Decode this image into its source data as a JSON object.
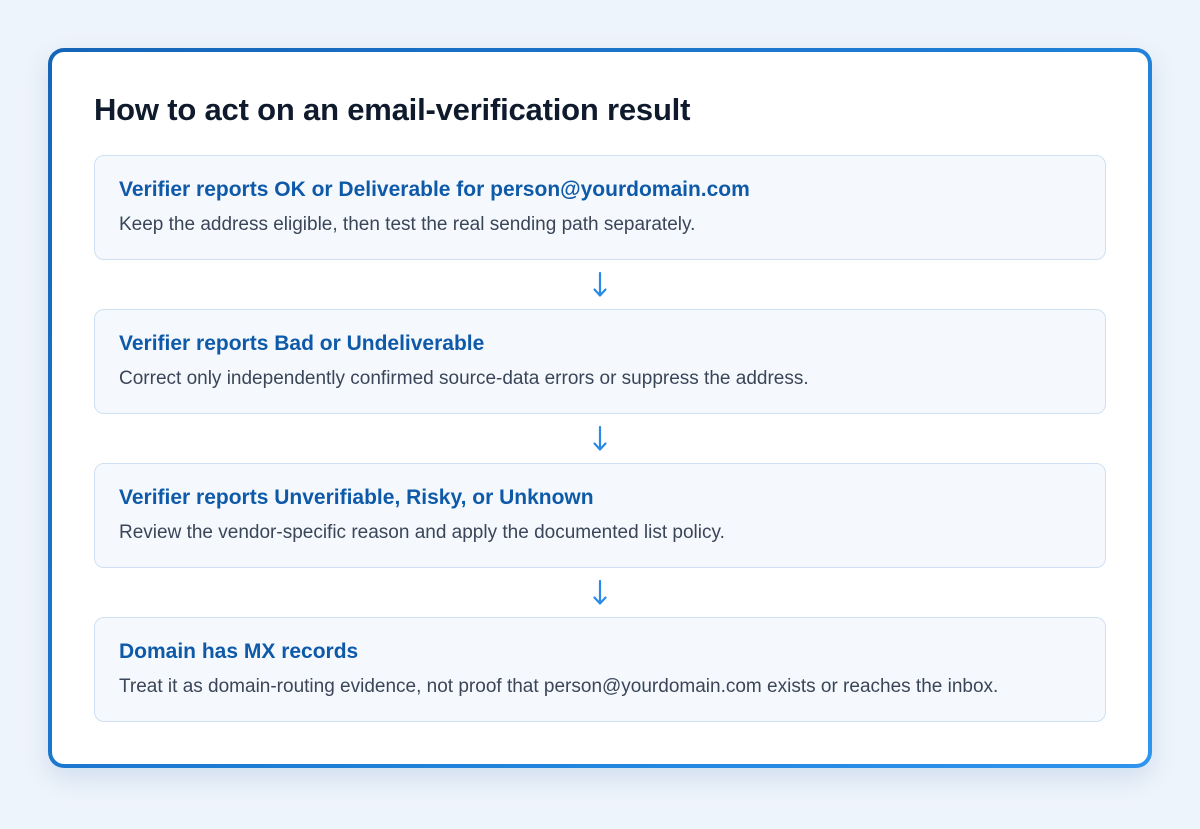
{
  "title": "How to act on an email-verification result",
  "steps": [
    {
      "heading": "Verifier reports OK or Deliverable for person@yourdomain.com",
      "description": "Keep the address eligible, then test the real sending path separately."
    },
    {
      "heading": "Verifier reports Bad or Undeliverable",
      "description": "Correct only independently confirmed source-data errors or suppress the address."
    },
    {
      "heading": "Verifier reports Unverifiable, Risky, or Unknown",
      "description": "Review the vendor-specific reason and apply the documented list policy."
    },
    {
      "heading": "Domain has MX records",
      "description": "Treat it as domain-routing evidence, not proof that person@yourdomain.com exists or reaches the inbox."
    }
  ],
  "colors": {
    "frame_border": "#1e7fd6",
    "step_heading": "#0f5aa8",
    "arrow": "#2a8be6"
  },
  "connector_icon": "arrow-down-icon"
}
